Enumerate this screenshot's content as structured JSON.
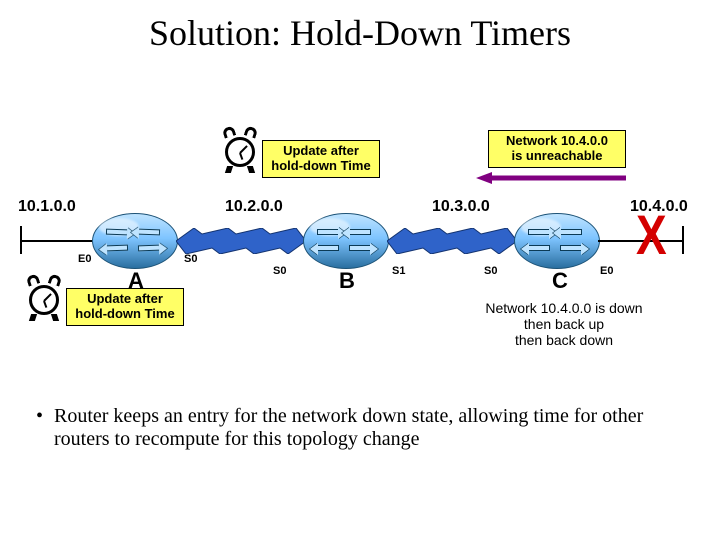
{
  "title": "Solution: Hold-Down Timers",
  "callouts": {
    "top_right": "Network 10.4.0.0\nis unreachable",
    "update_top": "Update after\nhold-down Time",
    "update_left": "Update after\nhold-down Time"
  },
  "networks": {
    "n1": "10.1.0.0",
    "n2": "10.2.0.0",
    "n3": "10.3.0.0",
    "n4": "10.4.0.0"
  },
  "routers": {
    "A": "A",
    "B": "B",
    "C": "C"
  },
  "interfaces": {
    "A_E0": "E0",
    "A_S0": "S0",
    "B_S0_left": "S0",
    "B_S1_right": "S1",
    "C_S0": "S0",
    "C_E0": "E0"
  },
  "status_note": "Network 10.4.0.0 is down\nthen back up\nthen back down",
  "bullet": "Router keeps an entry for the network down state, allowing time for other routers to recompute for this topology change",
  "icons": {
    "clock": "alarm-clock-icon",
    "x": "X"
  },
  "colors": {
    "callout_bg": "#ffff66",
    "wan": "#2f63c9",
    "arrow": "#800080",
    "x": "#d40000"
  }
}
